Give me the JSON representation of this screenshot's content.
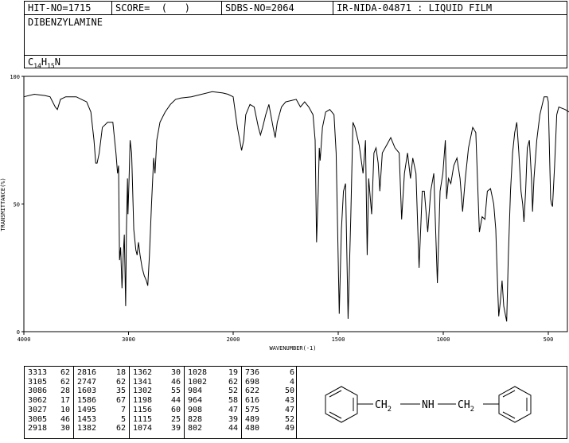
{
  "header": {
    "hit": "HIT-NO=1715",
    "score": "SCORE=  (   )",
    "sdbs": "SDBS-NO=2064",
    "ir": "IR-NIDA-04871 : LIQUID FILM",
    "compound": "DIBENZYLAMINE",
    "formula": {
      "c": "C",
      "cn": "14",
      "h": "H",
      "hn": "15",
      "n": "N"
    }
  },
  "chart_data": {
    "type": "line",
    "xlabel": "WAVENUMBER(-1)",
    "ylabel": "TRANSMITTANCE(%)",
    "xlim": [
      4000,
      400
    ],
    "ylim": [
      0,
      100
    ],
    "x_ticks": [
      4000,
      3000,
      2000,
      1500,
      1000,
      500
    ],
    "y_ticks": [
      0,
      50,
      100
    ],
    "series": [
      {
        "points": [
          [
            4000,
            92
          ],
          [
            3900,
            93
          ],
          [
            3800,
            92.5
          ],
          [
            3750,
            92
          ],
          [
            3700,
            88
          ],
          [
            3680,
            87
          ],
          [
            3650,
            91
          ],
          [
            3600,
            92
          ],
          [
            3500,
            92
          ],
          [
            3450,
            91
          ],
          [
            3400,
            90
          ],
          [
            3360,
            86
          ],
          [
            3330,
            75
          ],
          [
            3313,
            66
          ],
          [
            3300,
            66
          ],
          [
            3280,
            70
          ],
          [
            3250,
            80
          ],
          [
            3200,
            82
          ],
          [
            3150,
            82
          ],
          [
            3120,
            70
          ],
          [
            3105,
            62
          ],
          [
            3095,
            65
          ],
          [
            3086,
            28
          ],
          [
            3075,
            33
          ],
          [
            3062,
            17
          ],
          [
            3050,
            30
          ],
          [
            3040,
            38
          ],
          [
            3027,
            10
          ],
          [
            3020,
            40
          ],
          [
            3010,
            60
          ],
          [
            3005,
            46
          ],
          [
            2995,
            60
          ],
          [
            2985,
            75
          ],
          [
            2970,
            70
          ],
          [
            2950,
            40
          ],
          [
            2930,
            32
          ],
          [
            2918,
            30
          ],
          [
            2905,
            35
          ],
          [
            2890,
            30
          ],
          [
            2870,
            25
          ],
          [
            2850,
            22
          ],
          [
            2830,
            20
          ],
          [
            2816,
            18
          ],
          [
            2800,
            30
          ],
          [
            2780,
            50
          ],
          [
            2760,
            68
          ],
          [
            2747,
            62
          ],
          [
            2730,
            75
          ],
          [
            2700,
            82
          ],
          [
            2650,
            86
          ],
          [
            2600,
            89
          ],
          [
            2550,
            91
          ],
          [
            2500,
            91.5
          ],
          [
            2400,
            92
          ],
          [
            2300,
            93
          ],
          [
            2200,
            94
          ],
          [
            2100,
            93.5
          ],
          [
            2050,
            93
          ],
          [
            2000,
            92
          ],
          [
            1980,
            80
          ],
          [
            1960,
            71
          ],
          [
            1950,
            75
          ],
          [
            1940,
            85
          ],
          [
            1920,
            89
          ],
          [
            1900,
            88
          ],
          [
            1880,
            80
          ],
          [
            1870,
            77
          ],
          [
            1860,
            80
          ],
          [
            1845,
            85
          ],
          [
            1830,
            89
          ],
          [
            1810,
            80
          ],
          [
            1800,
            76
          ],
          [
            1790,
            82
          ],
          [
            1770,
            88
          ],
          [
            1750,
            90
          ],
          [
            1700,
            91
          ],
          [
            1680,
            88
          ],
          [
            1660,
            90
          ],
          [
            1640,
            88
          ],
          [
            1620,
            85
          ],
          [
            1610,
            75
          ],
          [
            1603,
            35
          ],
          [
            1595,
            55
          ],
          [
            1590,
            72
          ],
          [
            1586,
            67
          ],
          [
            1575,
            80
          ],
          [
            1560,
            86
          ],
          [
            1540,
            87
          ],
          [
            1520,
            85
          ],
          [
            1510,
            70
          ],
          [
            1495,
            7
          ],
          [
            1485,
            40
          ],
          [
            1475,
            55
          ],
          [
            1465,
            58
          ],
          [
            1453,
            5
          ],
          [
            1440,
            45
          ],
          [
            1430,
            82
          ],
          [
            1420,
            80
          ],
          [
            1400,
            73
          ],
          [
            1382,
            62
          ],
          [
            1370,
            75
          ],
          [
            1362,
            30
          ],
          [
            1355,
            60
          ],
          [
            1341,
            46
          ],
          [
            1330,
            70
          ],
          [
            1320,
            72
          ],
          [
            1310,
            66
          ],
          [
            1302,
            55
          ],
          [
            1290,
            70
          ],
          [
            1270,
            73
          ],
          [
            1250,
            76
          ],
          [
            1230,
            72
          ],
          [
            1210,
            70
          ],
          [
            1198,
            44
          ],
          [
            1185,
            62
          ],
          [
            1170,
            70
          ],
          [
            1156,
            60
          ],
          [
            1145,
            68
          ],
          [
            1130,
            62
          ],
          [
            1115,
            25
          ],
          [
            1100,
            55
          ],
          [
            1090,
            55
          ],
          [
            1074,
            39
          ],
          [
            1060,
            55
          ],
          [
            1045,
            62
          ],
          [
            1028,
            19
          ],
          [
            1015,
            55
          ],
          [
            1002,
            62
          ],
          [
            990,
            75
          ],
          [
            984,
            52
          ],
          [
            975,
            60
          ],
          [
            964,
            58
          ],
          [
            950,
            65
          ],
          [
            935,
            68
          ],
          [
            920,
            60
          ],
          [
            908,
            47
          ],
          [
            895,
            60
          ],
          [
            880,
            72
          ],
          [
            860,
            80
          ],
          [
            845,
            78
          ],
          [
            828,
            39
          ],
          [
            815,
            45
          ],
          [
            802,
            44
          ],
          [
            790,
            55
          ],
          [
            775,
            56
          ],
          [
            760,
            50
          ],
          [
            750,
            40
          ],
          [
            740,
            15
          ],
          [
            736,
            6
          ],
          [
            728,
            12
          ],
          [
            720,
            20
          ],
          [
            712,
            10
          ],
          [
            698,
            4
          ],
          [
            690,
            30
          ],
          [
            680,
            55
          ],
          [
            670,
            70
          ],
          [
            660,
            78
          ],
          [
            650,
            82
          ],
          [
            640,
            70
          ],
          [
            630,
            55
          ],
          [
            622,
            50
          ],
          [
            616,
            43
          ],
          [
            608,
            55
          ],
          [
            600,
            72
          ],
          [
            590,
            75
          ],
          [
            580,
            60
          ],
          [
            575,
            47
          ],
          [
            568,
            60
          ],
          [
            555,
            75
          ],
          [
            540,
            85
          ],
          [
            520,
            92
          ],
          [
            505,
            92
          ],
          [
            500,
            90
          ],
          [
            489,
            52
          ],
          [
            485,
            50
          ],
          [
            480,
            49
          ],
          [
            470,
            65
          ],
          [
            460,
            85
          ],
          [
            450,
            88
          ],
          [
            420,
            87
          ],
          [
            400,
            86
          ]
        ]
      }
    ]
  },
  "peaks": [
    [
      [
        "3313",
        "62"
      ],
      [
        "3105",
        "62"
      ],
      [
        "3086",
        "28"
      ],
      [
        "3062",
        "17"
      ],
      [
        "3027",
        "10"
      ],
      [
        "3005",
        "46"
      ],
      [
        "2918",
        "30"
      ]
    ],
    [
      [
        "2816",
        "18"
      ],
      [
        "2747",
        "62"
      ],
      [
        "1603",
        "35"
      ],
      [
        "1586",
        "67"
      ],
      [
        "1495",
        "7"
      ],
      [
        "1453",
        "5"
      ],
      [
        "1382",
        "62"
      ]
    ],
    [
      [
        "1362",
        "30"
      ],
      [
        "1341",
        "46"
      ],
      [
        "1302",
        "55"
      ],
      [
        "1198",
        "44"
      ],
      [
        "1156",
        "60"
      ],
      [
        "1115",
        "25"
      ],
      [
        "1074",
        "39"
      ]
    ],
    [
      [
        "1028",
        "19"
      ],
      [
        "1002",
        "62"
      ],
      [
        "984",
        "52"
      ],
      [
        "964",
        "58"
      ],
      [
        "908",
        "47"
      ],
      [
        "828",
        "39"
      ],
      [
        "802",
        "44"
      ]
    ],
    [
      [
        "736",
        "6"
      ],
      [
        "698",
        "4"
      ],
      [
        "622",
        "50"
      ],
      [
        "616",
        "43"
      ],
      [
        "575",
        "47"
      ],
      [
        "489",
        "52"
      ],
      [
        "480",
        "49"
      ]
    ]
  ],
  "structure": {
    "ch2": "CH",
    "sub2": "2",
    "nh": "NH"
  }
}
